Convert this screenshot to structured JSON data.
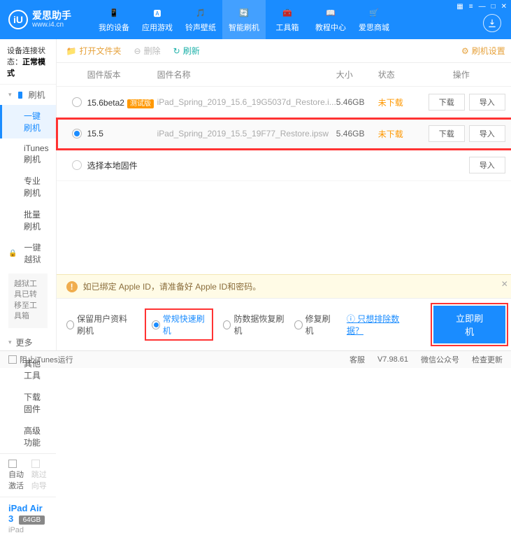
{
  "app": {
    "name": "爱思助手",
    "url": "www.i4.cn"
  },
  "nav": {
    "items": [
      {
        "label": "我的设备"
      },
      {
        "label": "应用游戏"
      },
      {
        "label": "铃声壁纸"
      },
      {
        "label": "智能刷机"
      },
      {
        "label": "工具箱"
      },
      {
        "label": "教程中心"
      },
      {
        "label": "爱思商城"
      }
    ],
    "active": 3
  },
  "sidebar": {
    "status_label": "设备连接状态：",
    "status_value": "正常模式",
    "sec_flash": "刷机",
    "items": [
      "一键刷机",
      "iTunes刷机",
      "专业刷机",
      "批量刷机"
    ],
    "sec_jb": "一键越狱",
    "jb_note": "越狱工具已转移至工具箱",
    "sec_more": "更多",
    "more": [
      "其他工具",
      "下载固件",
      "高级功能"
    ],
    "auto_activate": "自动激活",
    "skip_guide": "跳过向导",
    "device": {
      "name": "iPad Air 3",
      "cap": "64GB",
      "type": "iPad"
    }
  },
  "toolbar": {
    "open": "打开文件夹",
    "delete": "删除",
    "refresh": "刷新",
    "settings": "刷机设置"
  },
  "table": {
    "headers": {
      "ver": "固件版本",
      "name": "固件名称",
      "size": "大小",
      "stat": "状态",
      "op": "操作"
    },
    "rows": [
      {
        "ver": "15.6beta2",
        "badge": "测试版",
        "name": "iPad_Spring_2019_15.6_19G5037d_Restore.i...",
        "size": "5.46GB",
        "stat": "未下载",
        "selected": false,
        "hl": false
      },
      {
        "ver": "15.5",
        "badge": "",
        "name": "iPad_Spring_2019_15.5_19F77_Restore.ipsw",
        "size": "5.46GB",
        "stat": "未下载",
        "selected": true,
        "hl": true
      }
    ],
    "local": "选择本地固件",
    "btn_dl": "下载",
    "btn_imp": "导入"
  },
  "notice": "如已绑定 Apple ID，请准备好 Apple ID和密码。",
  "modes": {
    "opts": [
      "保留用户资料刷机",
      "常规快速刷机",
      "防数据恢复刷机",
      "修复刷机"
    ],
    "selected": 1,
    "link": "只想排除数据？",
    "flash": "立即刷机"
  },
  "footer": {
    "block": "阻止iTunes运行",
    "cs": "客服",
    "ver": "V7.98.61",
    "wx": "微信公众号",
    "upd": "检查更新"
  }
}
